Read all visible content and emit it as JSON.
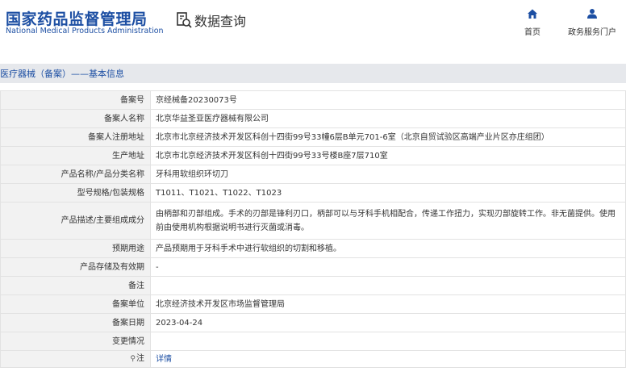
{
  "header": {
    "logo_cn": "国家药品监督管理局",
    "logo_en": "National Medical Products Administration",
    "query_label": "数据查询",
    "nav": [
      {
        "label": "首页",
        "icon": "home-icon"
      },
      {
        "label": "政务服务门户",
        "icon": "user-icon"
      }
    ]
  },
  "section": {
    "title": "医疗器械（备案）——基本信息"
  },
  "rows": [
    {
      "key": "备案号",
      "value": "京经械备20230073号"
    },
    {
      "key": "备案人名称",
      "value": "北京华益圣亚医疗器械有限公司"
    },
    {
      "key": "备案人注册地址",
      "value": "北京市北京经济技术开发区科创十四街99号33幢6层B单元701-6室（北京自贸试验区高端产业片区亦庄组团）"
    },
    {
      "key": "生产地址",
      "value": "北京市北京经济技术开发区科创十四街99号33号楼B座7层710室"
    },
    {
      "key": "产品名称/产品分类名称",
      "value": "牙科用软组织环切刀"
    },
    {
      "key": "型号规格/包装规格",
      "value": "T1011、T1021、T1022、T1023"
    },
    {
      "key": "产品描述/主要组成成分",
      "value": "由柄部和刃部组成。手术的刃部是锋利刃口，柄部可以与牙科手机相配合，传递工作扭力，实现刃部旋转工作。非无菌提供。使用前由使用机构根据说明书进行灭菌或消毒。"
    },
    {
      "key": "预期用途",
      "value": "产品预期用于牙科手术中进行软组织的切割和移植。"
    },
    {
      "key": "产品存储及有效期",
      "value": "-"
    },
    {
      "key": "备注",
      "value": ""
    },
    {
      "key": "备案单位",
      "value": "北京经济技术开发区市场监督管理局"
    },
    {
      "key": "备案日期",
      "value": "2023-04-24"
    },
    {
      "key": "变更情况",
      "value": ""
    },
    {
      "key": "注",
      "value": "详情"
    }
  ]
}
